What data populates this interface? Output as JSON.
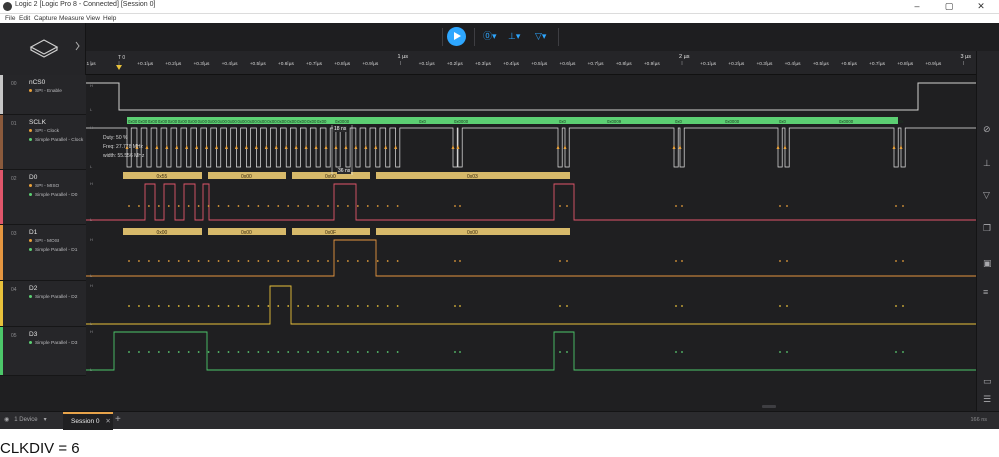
{
  "window": {
    "title": "Logic 2 [Logic Pro 8 - Connected] [Session 0]",
    "minimize": "–",
    "maximize": "▢",
    "close": "✕"
  },
  "menu": [
    "File",
    "Edit",
    "Capture",
    "Measure",
    "View",
    "Help"
  ],
  "toolbar": {
    "play_icon": "play-icon",
    "analyzer_icon": "analyzers-icon",
    "measure_icon": "measurement-icon",
    "marker_icon": "marker-icon",
    "accent": "#2ea7ff"
  },
  "ruler": {
    "major": [
      "1 µs",
      "2 µs",
      "3 µs"
    ],
    "labels_row": [
      "-0.1 µs",
      "+0.1 µs",
      "+0.2 µs",
      "+0.3 µs",
      "+0.4 µs",
      "+0.5 µs",
      "+0.6 µs",
      "+0.7 µs",
      "+0.8 µs",
      "+0.9 µs",
      "+0.1 µs",
      "+0.2 µs",
      "+0.3 µs",
      "+0.4 µs",
      "+0.5 µs",
      "+0.6 µs",
      "+0.7 µs",
      "+0.8 µs",
      "+0.9 µs",
      "+0.1 µs",
      "+0.2 µs",
      "+0.3 µs",
      "+0.4 µs",
      "+0.5 µs",
      "+0.6 µs",
      "+0.7 µs",
      "+0.8 µs",
      "+0.9 µs"
    ],
    "trigger_label": "T 0"
  },
  "channels": [
    {
      "num": "00",
      "name": "nCS0",
      "color": "#c7c7c7",
      "analyzers": [
        {
          "label": "SPI - Enable",
          "color": "#e9a13b"
        }
      ]
    },
    {
      "num": "01",
      "name": "SCLK",
      "color": "#8b5a3c",
      "analyzers": [
        {
          "label": "SPI - Clock",
          "color": "#e9a13b"
        },
        {
          "label": "Simple Parallel - Clock",
          "color": "#5ccf73"
        }
      ]
    },
    {
      "num": "02",
      "name": "D0",
      "color": "#e0566b",
      "analyzers": [
        {
          "label": "SPI - MISO",
          "color": "#e9a13b"
        },
        {
          "label": "Simple Parallel - D0",
          "color": "#5ccf73"
        }
      ]
    },
    {
      "num": "03",
      "name": "D1",
      "color": "#e59640",
      "analyzers": [
        {
          "label": "SPI - MOSI",
          "color": "#e9a13b"
        },
        {
          "label": "Simple Parallel - D1",
          "color": "#5ccf73"
        }
      ]
    },
    {
      "num": "04",
      "name": "D2",
      "color": "#e8c13b",
      "analyzers": [
        {
          "label": "Simple Parallel - D2",
          "color": "#5ccf73"
        }
      ]
    },
    {
      "num": "05",
      "name": "D3",
      "color": "#4cc76a",
      "analyzers": [
        {
          "label": "Simple Parallel - D3",
          "color": "#5ccf73"
        }
      ]
    }
  ],
  "sclk_tooltip": {
    "duty": "Duty: 50 %",
    "freq": "Freq: 27.778 MHz",
    "width": "width: 55.556 MHz"
  },
  "measure_18ns": "18 ns",
  "measure_36ns": "36 ns",
  "parallel_values": [
    "0x00",
    "0x00",
    "0x00",
    "0x00",
    "0x00",
    "0x00",
    "0x00",
    "0x00",
    "0x00",
    "0x00",
    "0x00",
    "0x00",
    "0x00",
    "0x00",
    "0x00",
    "0x00",
    "0x00",
    "0x00",
    "0x00",
    "0x00",
    "0x0000",
    "0x0",
    "0x0000",
    "0x0",
    "0x0009",
    "0x0",
    "0x0000",
    "0x0",
    "0x0000",
    "0x"
  ],
  "spi_miso": [
    "0x55",
    "0x00",
    "0x00",
    "0x03"
  ],
  "spi_mosi": [
    "0x00",
    "0x00",
    "0x0F",
    "0x00"
  ],
  "tabs": {
    "device": "1 Device",
    "session": "Session 0",
    "close": "✕",
    "add": "+"
  },
  "status": {
    "zoom": "166 ns"
  },
  "caption": "CLKDIV = 6"
}
